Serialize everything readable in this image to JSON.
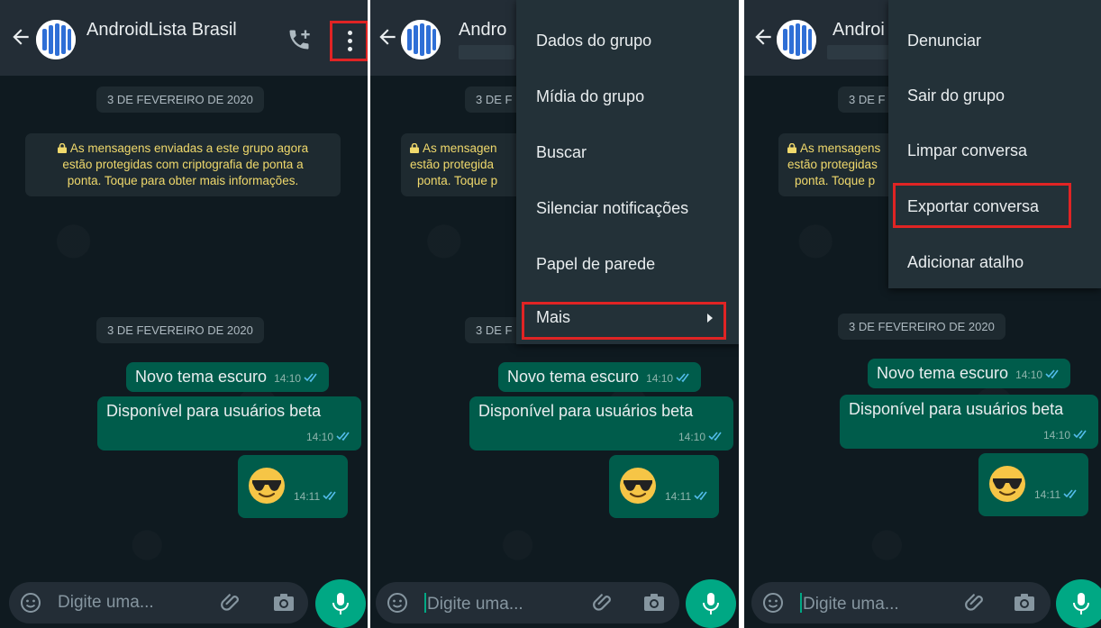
{
  "header": {
    "group_name_full": "AndroidLista Brasil",
    "group_name_short": "Andro",
    "group_name_short3": "Androi"
  },
  "chat": {
    "date_label": "3 DE FEVEREIRO DE 2020",
    "date_label_short2": "3 DE F",
    "date_label_short3": "3 DE F",
    "encryption_full": [
      "As mensagens enviadas a este grupo agora",
      "estão protegidas com criptografia de ponta a",
      "ponta. Toque para obter mais informações."
    ],
    "encryption_cut": [
      "As mensagen",
      "estão protegida",
      "ponta. Toque p"
    ],
    "encryption_cut3": [
      "As mensagens",
      "estão protegidas",
      "ponta. Toque p"
    ],
    "messages": [
      {
        "text": "Novo tema escuro",
        "time": "14:10"
      },
      {
        "text": "Disponível para usuários beta",
        "time": "14:10"
      },
      {
        "text": "",
        "time": "14:11",
        "emoji": "smiling-face-with-sunglasses"
      }
    ]
  },
  "input": {
    "placeholder": "Digite uma..."
  },
  "menu_main": {
    "items": [
      "Dados do grupo",
      "Mídia do grupo",
      "Buscar",
      "Silenciar notificações",
      "Papel de parede",
      "Mais"
    ],
    "highlighted": "Mais"
  },
  "menu_more": {
    "items": [
      "Denunciar",
      "Sair do grupo",
      "Limpar conversa",
      "Exportar conversa",
      "Adicionar atalho"
    ],
    "highlighted": "Exportar conversa"
  },
  "colors": {
    "header": "#232d36",
    "outgoing_bubble": "#005c4b",
    "accent": "#00a884",
    "highlight_box": "#e02424",
    "encryption_text": "#f0d96c"
  }
}
